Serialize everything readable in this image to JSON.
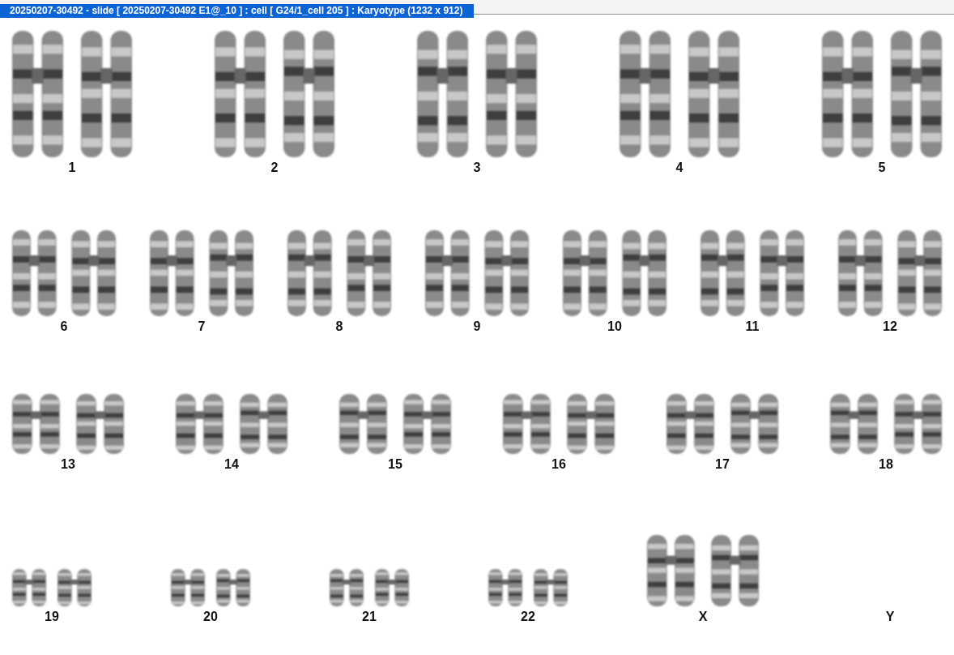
{
  "window": {
    "title": "20250207-30492 - slide [ 20250207-30492 E1@_10 ] : cell [ G24/1_cell 205 ] : Karyotype  (1232 x 912)"
  },
  "karyotype_rows": [
    [
      {
        "label": "1",
        "kind": "pair"
      },
      {
        "label": "2",
        "kind": "pair"
      },
      {
        "label": "3",
        "kind": "pair"
      },
      {
        "label": "4",
        "kind": "pair"
      },
      {
        "label": "5",
        "kind": "pair"
      }
    ],
    [
      {
        "label": "6",
        "kind": "pair"
      },
      {
        "label": "7",
        "kind": "pair"
      },
      {
        "label": "8",
        "kind": "pair"
      },
      {
        "label": "9",
        "kind": "pair"
      },
      {
        "label": "10",
        "kind": "pair"
      },
      {
        "label": "11",
        "kind": "pair"
      },
      {
        "label": "12",
        "kind": "pair"
      }
    ],
    [
      {
        "label": "13",
        "kind": "pair"
      },
      {
        "label": "14",
        "kind": "pair"
      },
      {
        "label": "15",
        "kind": "pair"
      },
      {
        "label": "16",
        "kind": "pair"
      },
      {
        "label": "17",
        "kind": "pair"
      },
      {
        "label": "18",
        "kind": "pair"
      }
    ],
    [
      {
        "label": "19",
        "kind": "pair"
      },
      {
        "label": "20",
        "kind": "pair"
      },
      {
        "label": "21",
        "kind": "pair"
      },
      {
        "label": "22",
        "kind": "pair"
      },
      {
        "label": "X",
        "kind": "pair"
      },
      {
        "label": "Y",
        "kind": "empty"
      }
    ]
  ]
}
